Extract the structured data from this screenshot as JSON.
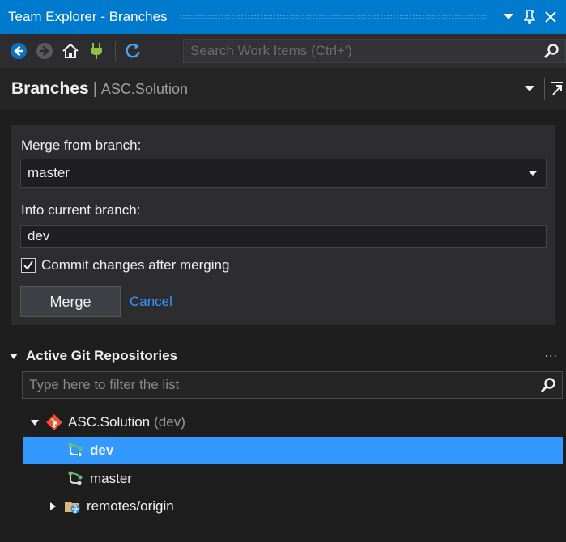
{
  "window": {
    "title": "Team Explorer - Branches"
  },
  "toolbar": {
    "search_placeholder": "Search Work Items (Ctrl+')"
  },
  "header": {
    "page_title": "Branches",
    "separator": "|",
    "context": "ASC.Solution"
  },
  "merge": {
    "from_label": "Merge from branch:",
    "from_value": "master",
    "into_label": "Into current branch:",
    "into_value": "dev",
    "commit_label": "Commit changes after merging",
    "commit_checked": true,
    "merge_button": "Merge",
    "cancel_link": "Cancel"
  },
  "repos": {
    "title": "Active Git Repositories",
    "more": "...",
    "filter_placeholder": "Type here to filter the list",
    "repo_name": "ASC.Solution",
    "repo_branch": "(dev)",
    "branches": [
      {
        "label": "dev",
        "selected": true
      },
      {
        "label": "master",
        "selected": false
      }
    ],
    "remotes_label": "remotes/origin"
  },
  "colors": {
    "accent": "#007acc",
    "selection": "#3399ff",
    "link": "#3399ff",
    "git_brand": "#f05133",
    "branch_icon": "#6abf69"
  }
}
